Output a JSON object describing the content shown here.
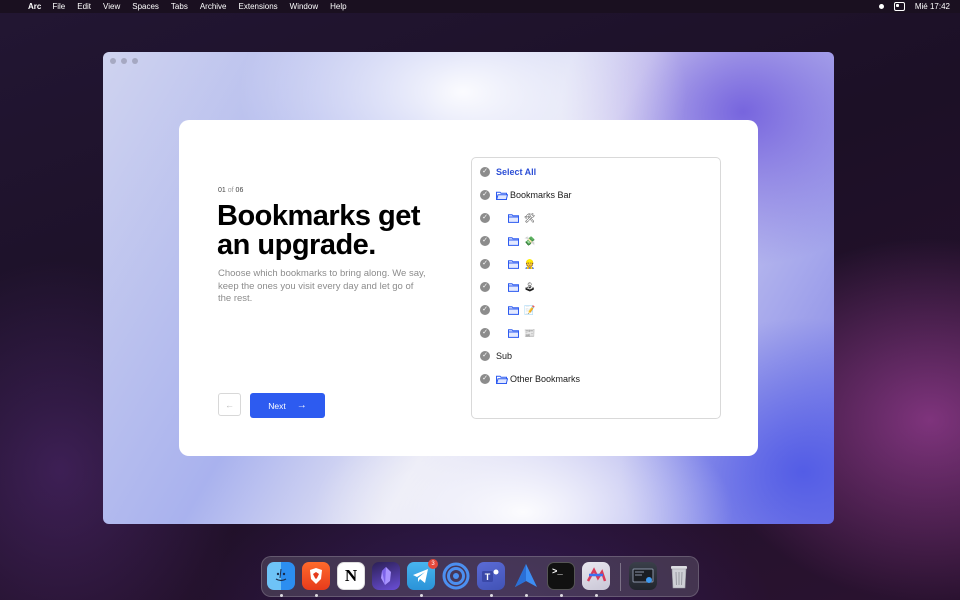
{
  "menubar": {
    "app": "Arc",
    "items": [
      "File",
      "Edit",
      "View",
      "Spaces",
      "Tabs",
      "Archive",
      "Extensions",
      "Window",
      "Help"
    ],
    "clock": "Mié 17:42"
  },
  "onboarding": {
    "step_current": "01",
    "step_of": "of",
    "step_total": "06",
    "title": "Bookmarks get an upgrade.",
    "description": "Choose which bookmarks to bring along. We say, keep the ones you visit every day and let go of the rest.",
    "back_icon": "arrow-left-icon",
    "next_label": "Next",
    "next_icon": "arrow-right-icon"
  },
  "bookmarks": {
    "select_all": "Select All",
    "items": [
      {
        "label": "Bookmarks Bar",
        "type": "folder-open",
        "level": 0
      },
      {
        "label": "🛠",
        "type": "folder",
        "level": 1
      },
      {
        "label": "💸",
        "type": "folder",
        "level": 1
      },
      {
        "label": "👷",
        "type": "folder",
        "level": 1
      },
      {
        "label": "🕹",
        "type": "folder",
        "level": 1
      },
      {
        "label": "📝",
        "type": "folder",
        "level": 1
      },
      {
        "label": "📰",
        "type": "folder",
        "level": 1
      },
      {
        "label": "Sub",
        "type": "item",
        "level": 0
      },
      {
        "label": "Other Bookmarks",
        "type": "folder-open",
        "level": 0
      }
    ]
  },
  "dock": {
    "apps": [
      "finder-icon",
      "brave-icon",
      "notion-icon",
      "obsidian-icon",
      "telegram-icon",
      "airdrop-icon",
      "teams-icon",
      "arc-navigate-icon",
      "terminal-icon",
      "map-app-icon",
      "screen-app-icon",
      "trash-icon"
    ],
    "telegram_badge": "3"
  },
  "colors": {
    "accent": "#2d5bf0",
    "select_all": "#2d4fd6"
  }
}
